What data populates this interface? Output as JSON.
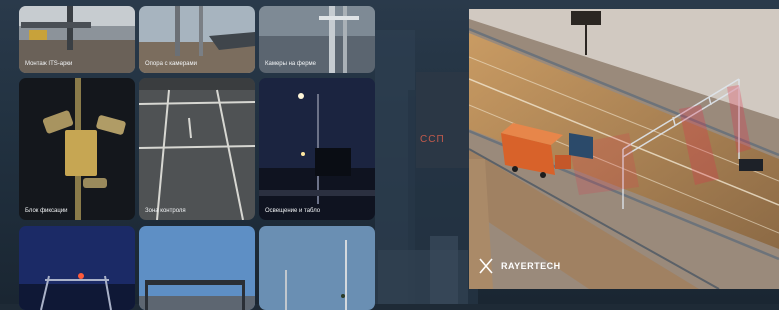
{
  "background": {
    "sign_text": "ССП"
  },
  "gallery": {
    "tiles": [
      {
        "caption": "Монтаж ITS-арки"
      },
      {
        "caption": "Опора с камерами"
      },
      {
        "caption": "Камеры на ферме"
      },
      {
        "caption": "Блок фиксации"
      },
      {
        "caption": "Зона контроля"
      },
      {
        "caption": "Освещение и табло"
      },
      {
        "caption": ""
      },
      {
        "caption": ""
      },
      {
        "caption": ""
      }
    ]
  },
  "render": {
    "brand": "RAYERTECH"
  },
  "colors": {
    "background": "#1e2a36",
    "tile_caption": "#f2f4f6",
    "truck_cab": "#d8622a",
    "sensor_beam": "#e0304a",
    "brand_text": "#ffffff"
  }
}
